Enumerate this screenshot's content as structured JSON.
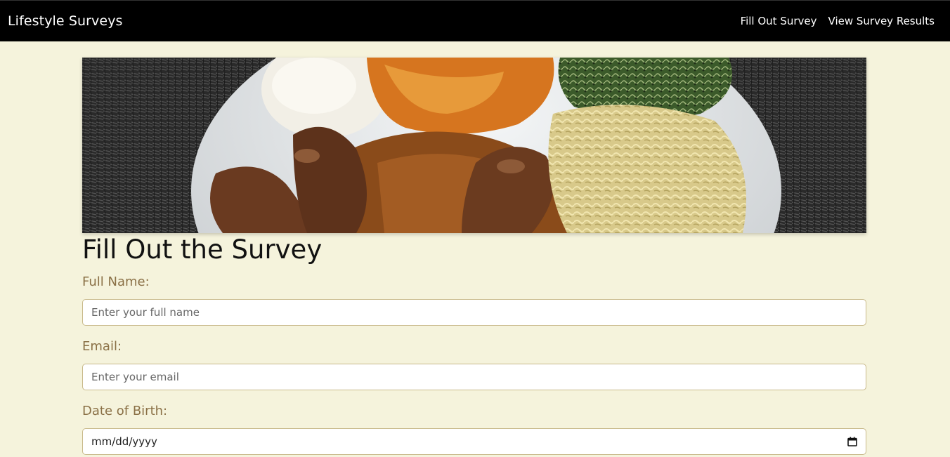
{
  "nav": {
    "brand": "Lifestyle Surveys",
    "links": [
      {
        "label": "Fill Out Survey"
      },
      {
        "label": "View Survey Results"
      }
    ]
  },
  "banner": {
    "icon": "food-plate-image"
  },
  "main": {
    "title": "Fill Out the Survey",
    "fields": {
      "full_name": {
        "label": "Full Name:",
        "placeholder": "Enter your full name",
        "value": ""
      },
      "email": {
        "label": "Email:",
        "placeholder": "Enter your email",
        "value": ""
      },
      "dob": {
        "label": "Date of Birth:",
        "placeholder": "mm/dd/yyyy",
        "icon": "calendar-icon"
      }
    }
  },
  "colors": {
    "navbar": "#000000",
    "background": "#f5f3dc",
    "label": "#8a7046",
    "field_border": "#c8b98a"
  }
}
